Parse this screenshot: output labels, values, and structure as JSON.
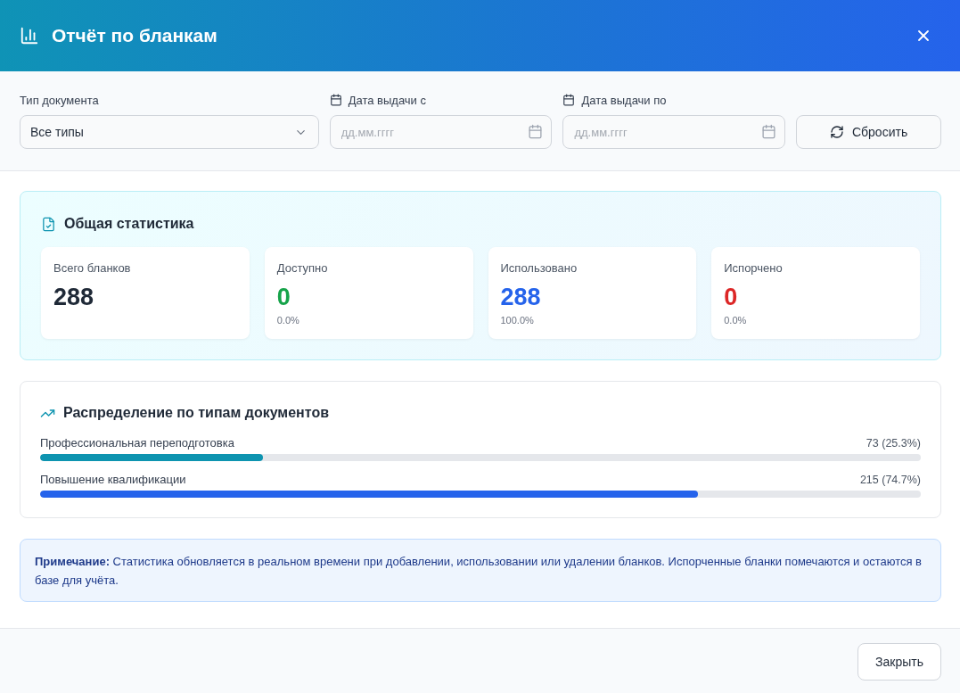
{
  "dialog": {
    "title": "Отчёт по бланкам"
  },
  "filters": {
    "document_type": {
      "label": "Тип документа",
      "value": "Все типы"
    },
    "date_from": {
      "label": "Дата выдачи с",
      "placeholder": "дд.мм.гггг"
    },
    "date_to": {
      "label": "Дата выдачи по",
      "placeholder": "дд.мм.гггг"
    },
    "reset_button": "Сбросить"
  },
  "overview": {
    "title": "Общая статистика",
    "cards": [
      {
        "label": "Всего бланков",
        "value": "288",
        "color": "#1f2937"
      },
      {
        "label": "Доступно",
        "value": "0",
        "share": "0.0%",
        "color": "#16a34a"
      },
      {
        "label": "Использовано",
        "value": "288",
        "share": "100.0%",
        "color": "#2563eb"
      },
      {
        "label": "Испорчено",
        "value": "0",
        "share": "0.0%",
        "color": "#dc2626"
      }
    ]
  },
  "distribution": {
    "title": "Распределение по типам документов",
    "items": [
      {
        "name": "Профессиональная переподготовка",
        "reading": "73 (25.3%)",
        "level": 0.253,
        "color": "#0e94b0"
      },
      {
        "name": "Повышение квалификации",
        "reading": "215 (74.7%)",
        "level": 0.747,
        "color": "#2563eb"
      }
    ]
  },
  "note": {
    "text": "**Примечание:** Статистика обновляется в реальном времени при добавлении, использовании или удалении бланков. Испорченные бланки помечаются и остаются в базе для учёта."
  },
  "footer": {
    "close_button": "Закрыть"
  }
}
